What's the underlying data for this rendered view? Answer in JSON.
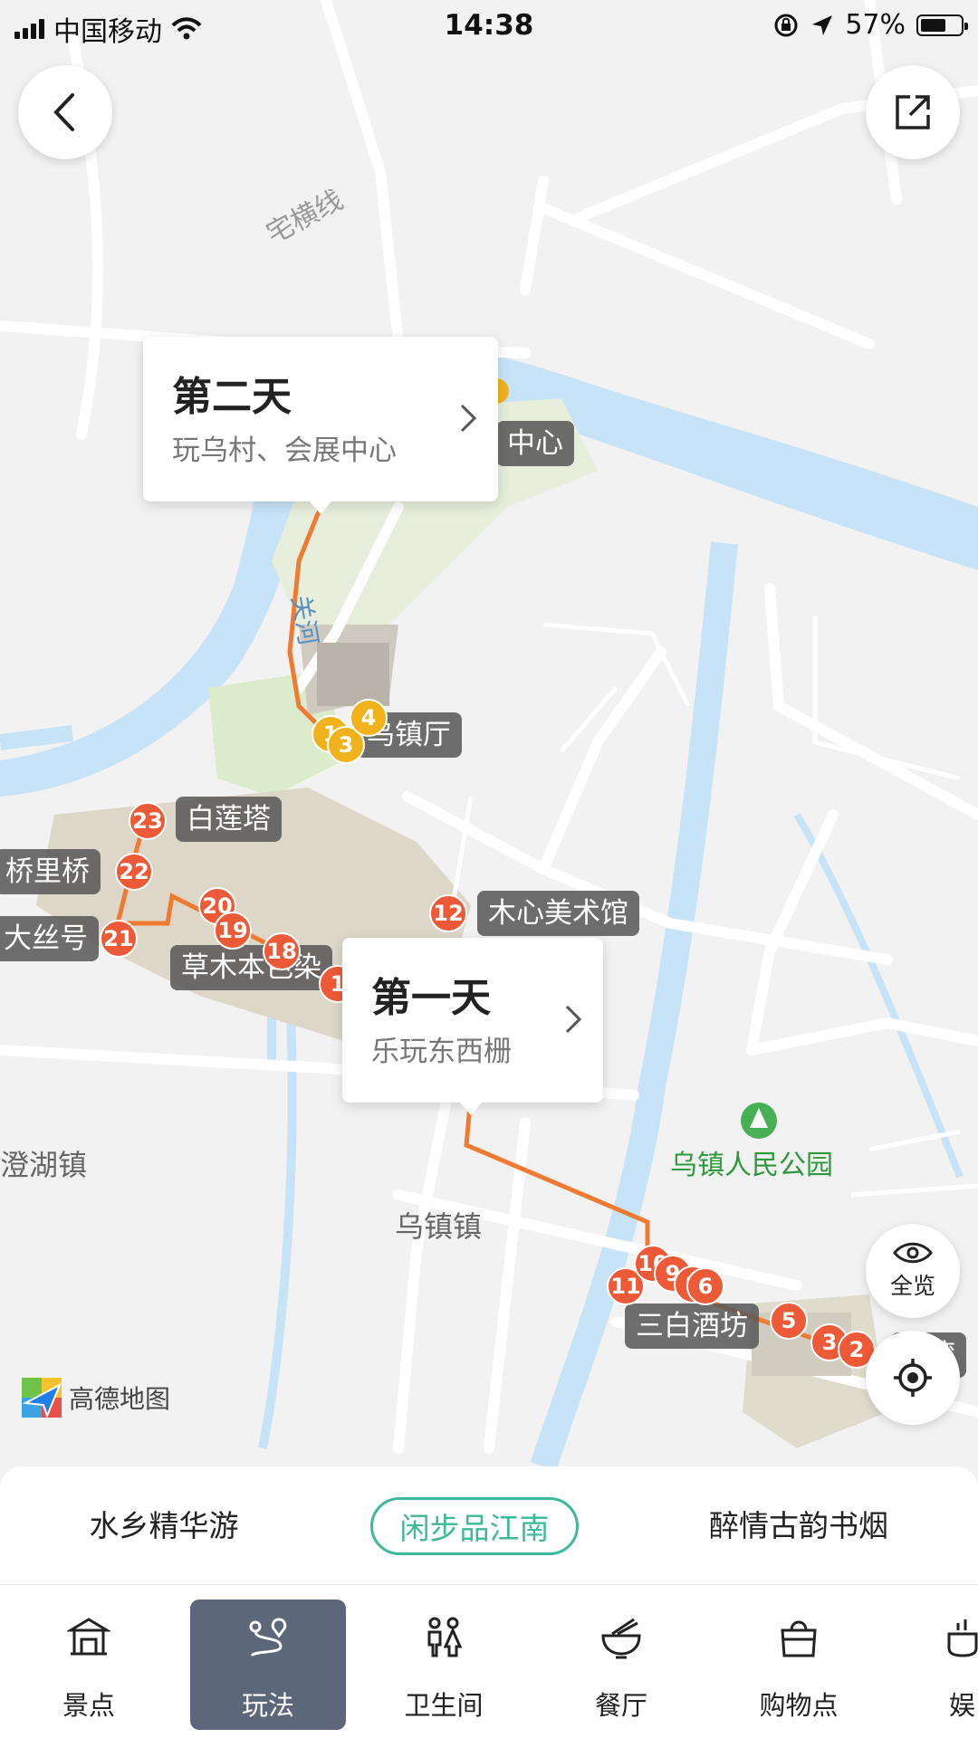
{
  "status_bar": {
    "carrier": "中国移动",
    "time": "14:38",
    "battery": "57%"
  },
  "map": {
    "road_label": "宅横线",
    "river_label": "关河",
    "town_labels": [
      "澄湖镇",
      "乌镇镇"
    ],
    "park_label": "乌镇人民公园",
    "poi_labels": {
      "center": "中心",
      "hall": "乌镇厅",
      "pagoda": "白莲塔",
      "bridge": "桥里桥",
      "silk": "大丝号",
      "dye": "草木本色染",
      "museum": "木心美术馆",
      "winery": "三白酒坊",
      "bay": "湾"
    },
    "day2_pins": [
      "1",
      "3",
      "4"
    ],
    "day1_pins": [
      "23",
      "22",
      "21",
      "20",
      "19",
      "18",
      "1",
      "12",
      "11",
      "10",
      "9",
      "8",
      "6",
      "5",
      "3",
      "2"
    ],
    "brand": "高德地图"
  },
  "day2_card": {
    "title": "第二天",
    "subtitle": "玩乌村、会展中心"
  },
  "day1_card": {
    "title": "第一天",
    "subtitle": "乐玩东西栅"
  },
  "overview_button": {
    "label": "全览"
  },
  "route_tabs": [
    {
      "label": "水乡精华游",
      "active": false
    },
    {
      "label": "闲步品江南",
      "active": true
    },
    {
      "label": "醉情古韵书烟",
      "active": false
    }
  ],
  "bottom_nav": [
    {
      "label": "景点",
      "icon": "scenic-spot-icon",
      "active": false
    },
    {
      "label": "玩法",
      "icon": "route-icon",
      "active": true
    },
    {
      "label": "卫生间",
      "icon": "restroom-icon",
      "active": false
    },
    {
      "label": "餐厅",
      "icon": "restaurant-icon",
      "active": false
    },
    {
      "label": "购物点",
      "icon": "shopping-bag-icon",
      "active": false
    },
    {
      "label": "娱",
      "icon": "entertainment-icon",
      "active": false
    }
  ],
  "colors": {
    "accent": "#3cb89a",
    "route": "#f07a32",
    "pin_red": "#ee5a37",
    "pin_yellow": "#f1b21c",
    "water": "#c7e3f7",
    "nav_active": "#5d677a"
  }
}
